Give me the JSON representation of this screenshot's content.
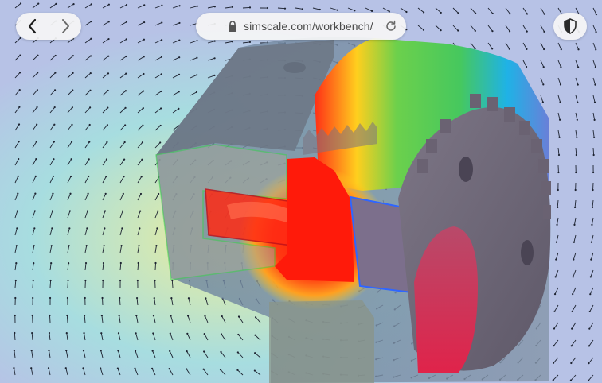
{
  "browser": {
    "url": "simscale.com/workbench/"
  },
  "icons": {
    "back": "chevron-left-icon",
    "forward": "chevron-right-icon",
    "lock": "lock-icon",
    "reload": "reload-icon",
    "shield": "shield-icon"
  },
  "colors": {
    "background": "#b9c4e4",
    "toolbar": "#f6f6f6",
    "hot": "#ff1a0a",
    "warm": "#ffd21a",
    "mid": "#5ad255",
    "cool": "#20b4e6"
  }
}
